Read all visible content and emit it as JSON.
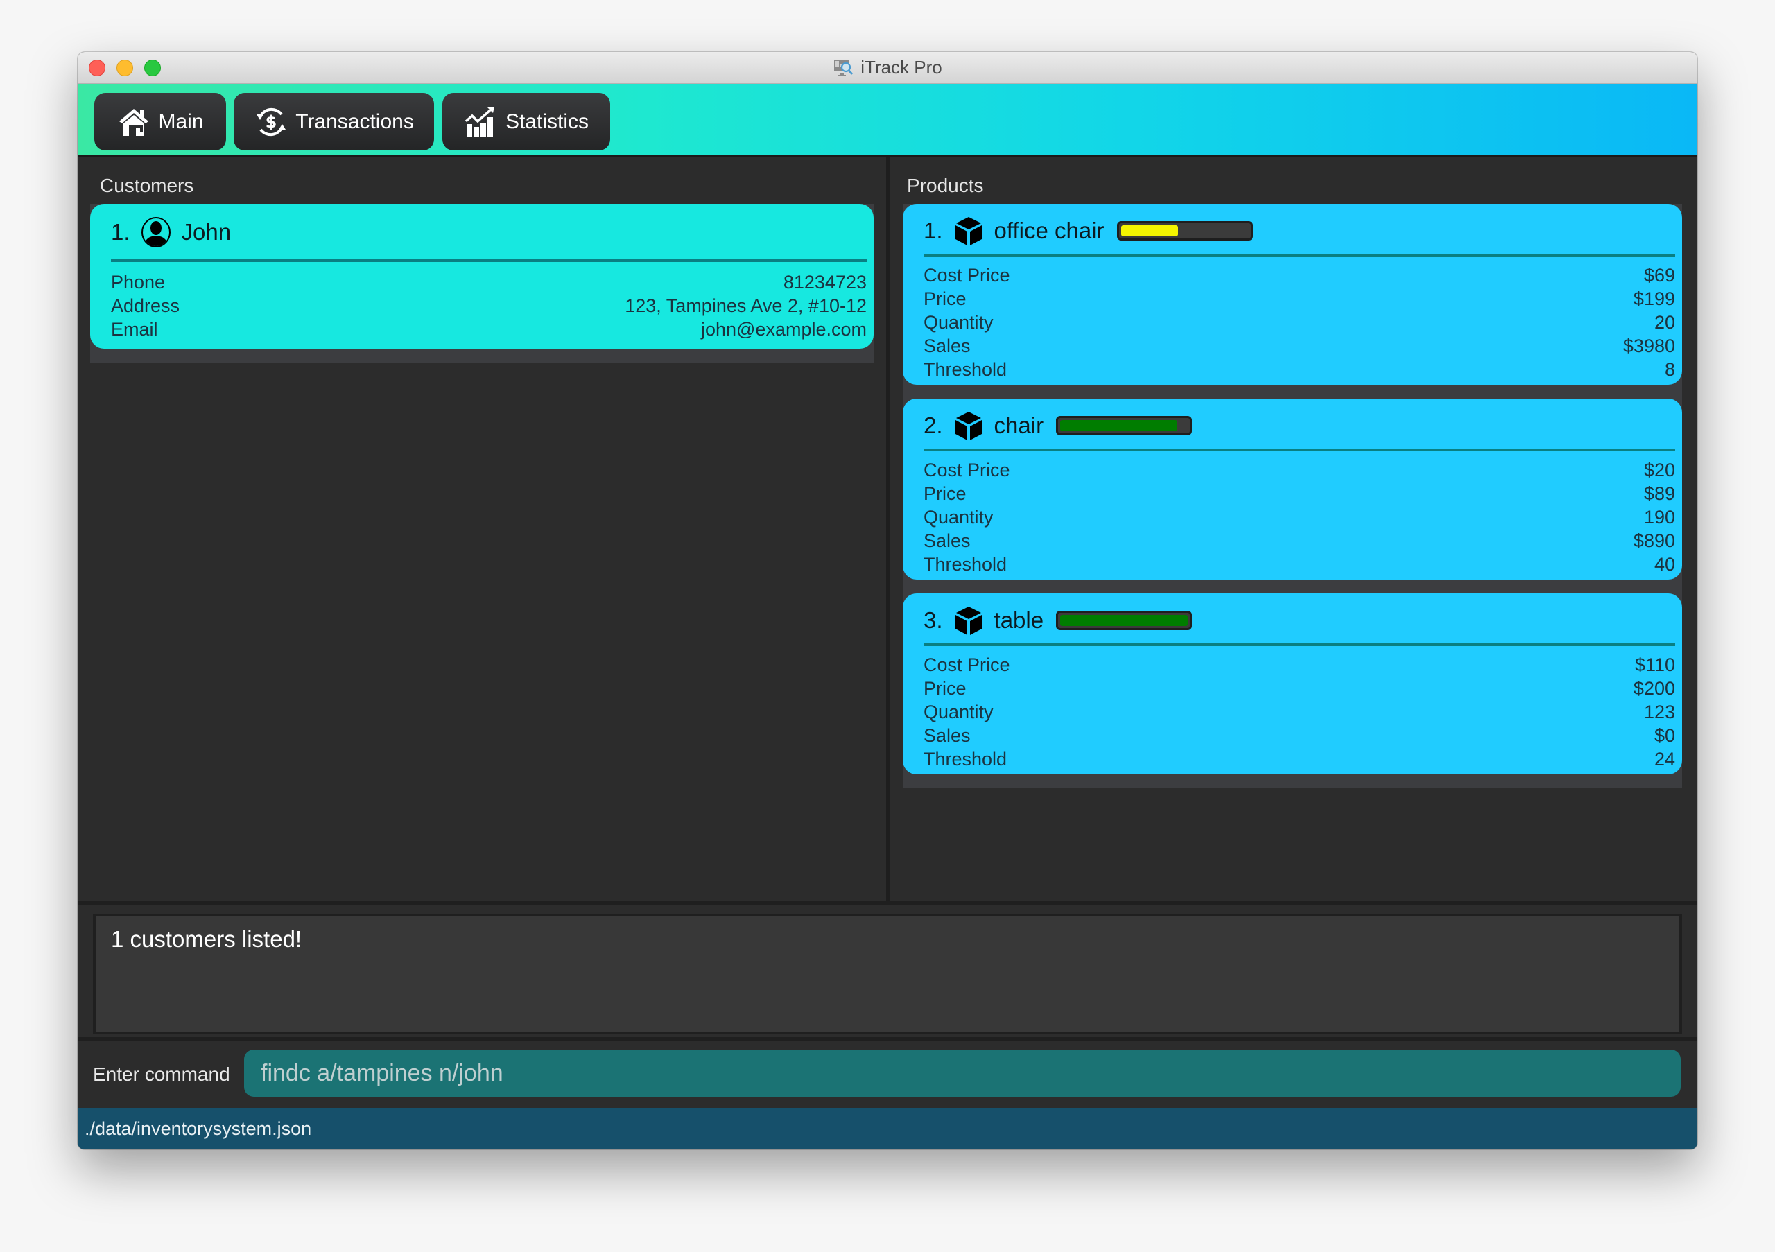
{
  "window": {
    "title": "iTrack Pro",
    "app_icon": "monitor-search-icon"
  },
  "nav": {
    "buttons": [
      {
        "label": "Main",
        "icon": "home-icon"
      },
      {
        "label": "Transactions",
        "icon": "dollar-cycle-icon"
      },
      {
        "label": "Statistics",
        "icon": "chart-growth-icon"
      }
    ]
  },
  "customers": {
    "heading": "Customers",
    "items": [
      {
        "index": "1.",
        "name": "John",
        "icon": "user-avatar-icon",
        "fields": [
          {
            "label": "Phone",
            "value": "81234723"
          },
          {
            "label": "Address",
            "value": "123, Tampines Ave 2, #10-12"
          },
          {
            "label": "Email",
            "value": "john@example.com"
          }
        ]
      }
    ]
  },
  "products": {
    "heading": "Products",
    "items": [
      {
        "index": "1.",
        "name": "office chair",
        "icon": "box-icon",
        "stock_level": 0.45,
        "stock_color": "#f5f500",
        "fields": [
          {
            "label": "Cost Price",
            "value": "$69"
          },
          {
            "label": "Price",
            "value": "$199"
          },
          {
            "label": "Quantity",
            "value": "20"
          },
          {
            "label": "Sales",
            "value": "$3980"
          },
          {
            "label": "Threshold",
            "value": "8"
          }
        ]
      },
      {
        "index": "2.",
        "name": "chair",
        "icon": "box-icon",
        "stock_level": 0.92,
        "stock_color": "#007d00",
        "fields": [
          {
            "label": "Cost Price",
            "value": "$20"
          },
          {
            "label": "Price",
            "value": "$89"
          },
          {
            "label": "Quantity",
            "value": "190"
          },
          {
            "label": "Sales",
            "value": "$890"
          },
          {
            "label": "Threshold",
            "value": "40"
          }
        ]
      },
      {
        "index": "3.",
        "name": "table",
        "icon": "box-icon",
        "stock_level": 1.0,
        "stock_color": "#007d00",
        "fields": [
          {
            "label": "Cost Price",
            "value": "$110"
          },
          {
            "label": "Price",
            "value": "$200"
          },
          {
            "label": "Quantity",
            "value": "123"
          },
          {
            "label": "Sales",
            "value": "$0"
          },
          {
            "label": "Threshold",
            "value": "24"
          }
        ]
      }
    ]
  },
  "result_display": {
    "text": "1 customers listed!"
  },
  "command_box": {
    "label": "Enter command",
    "value": "findc a/tampines n/john"
  },
  "status_bar": {
    "path": "./data/inventorysystem.json"
  },
  "colors": {
    "customer_card": "#17e8e0",
    "product_card": "#20ccff",
    "status_bar": "#16506b",
    "command_input": "#1b7374"
  }
}
